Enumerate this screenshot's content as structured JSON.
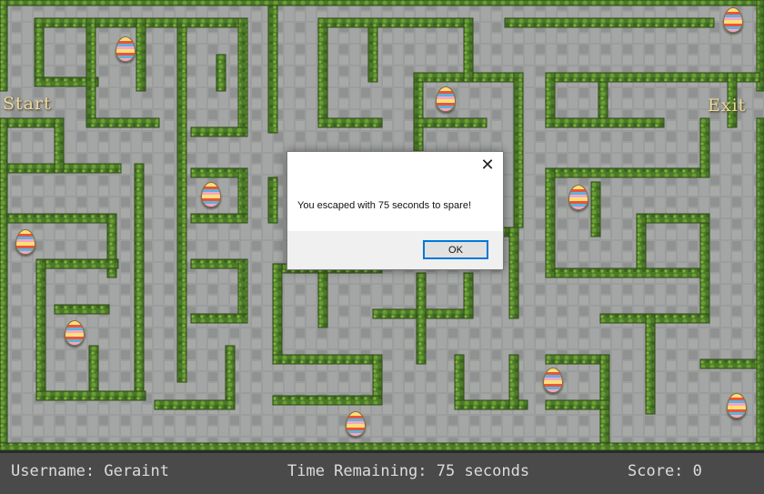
{
  "maze": {
    "start_label": "Start",
    "exit_label": "Exit"
  },
  "eggs": [
    {
      "name": "easter-egg"
    },
    {
      "name": "easter-egg"
    },
    {
      "name": "easter-egg"
    },
    {
      "name": "easter-egg"
    },
    {
      "name": "easter-egg"
    },
    {
      "name": "easter-egg"
    },
    {
      "name": "easter-egg"
    },
    {
      "name": "easter-egg"
    },
    {
      "name": "easter-egg"
    },
    {
      "name": "easter-egg"
    },
    {
      "name": "easter-egg"
    }
  ],
  "status": {
    "username": "Username: Geraint",
    "time_remaining": "Time Remaining: 75 seconds",
    "score": "Score: 0"
  },
  "dialog": {
    "message": "You escaped with 75 seconds to spare!",
    "ok_label": "OK",
    "close_icon": "close-icon"
  },
  "colors": {
    "path": "#9b9e9c",
    "hedge": "#4f7a2a",
    "hedge_light": "#6e9e3a",
    "status_bar": "#4a4a4a",
    "accent": "#0078d7"
  }
}
